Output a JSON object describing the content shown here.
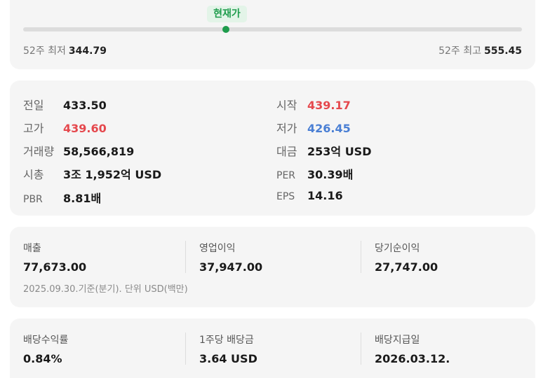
{
  "range": {
    "current_label": "현재가",
    "current_position": 0.406,
    "low_label": "52주 최저",
    "low_value": "344.79",
    "high_label": "52주 최고",
    "high_value": "555.45"
  },
  "stats": {
    "prev_close_label": "전일",
    "prev_close_value": "433.50",
    "open_label": "시작",
    "open_value": "439.17",
    "high_label": "고가",
    "high_value": "439.60",
    "low_label": "저가",
    "low_value": "426.45",
    "volume_label": "거래량",
    "volume_value": "58,566,819",
    "turnover_label": "대금",
    "turnover_value": "253억 USD",
    "market_cap_label": "시총",
    "market_cap_value": "3조 1,952억 USD",
    "per_label": "PER",
    "per_value": "30.39배",
    "pbr_label": "PBR",
    "pbr_value": "8.81배",
    "eps_label": "EPS",
    "eps_value": "14.16",
    "colors": {
      "up": "#e5484d",
      "down": "#4a7fd4"
    }
  },
  "income": {
    "revenue_label": "매출",
    "revenue_value": "77,673.00",
    "operating_label": "영업이익",
    "operating_value": "37,947.00",
    "net_label": "당기순이익",
    "net_value": "27,747.00",
    "footnote": "2025.09.30.기준(분기). 단위 USD(백만)"
  },
  "dividend": {
    "yield_label": "배당수익률",
    "yield_value": "0.84%",
    "per_share_label": "1주당 배당금",
    "per_share_value": "3.64 USD",
    "pay_date_label": "배당지급일",
    "pay_date_value": "2026.03.12."
  }
}
